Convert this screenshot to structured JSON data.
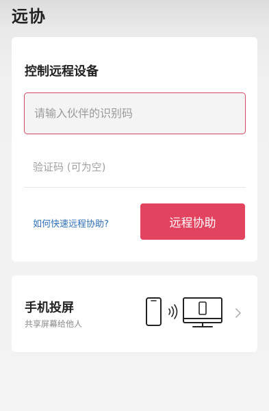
{
  "page": {
    "title": "远协"
  },
  "remote_control": {
    "title": "控制远程设备",
    "id_input": {
      "placeholder": "请输入伙伴的识别码",
      "value": ""
    },
    "code_input": {
      "placeholder": "验证码 (可为空)",
      "value": ""
    },
    "help_link": "如何快速远程协助?",
    "button_label": "远程协助",
    "accent_color": "#e2435f",
    "link_color": "#2e6fb7"
  },
  "screen_cast": {
    "title": "手机投屏",
    "subtitle": "共享屏幕给他人",
    "icons": [
      "phone-icon",
      "signal-waves-icon",
      "monitor-icon",
      "chevron-right-icon"
    ]
  }
}
